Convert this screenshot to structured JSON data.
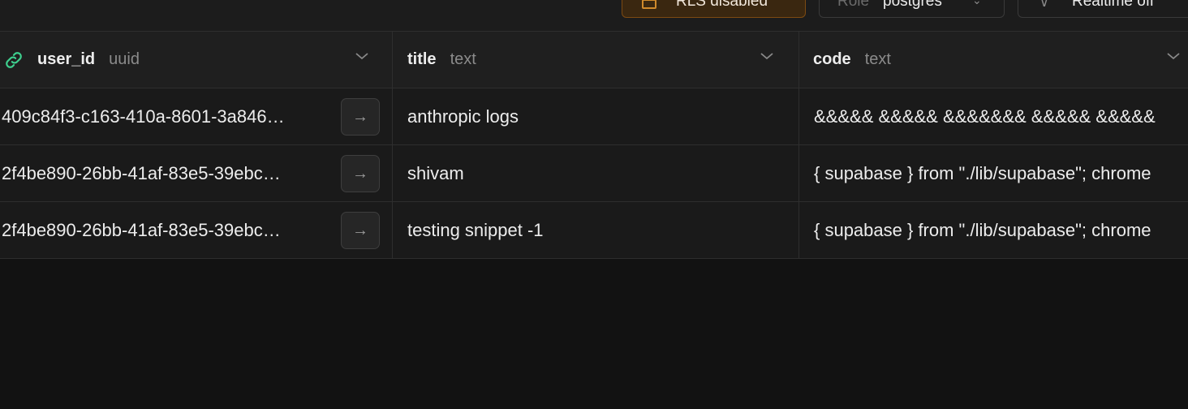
{
  "toolbar": {
    "rls_label": "RLS disabled",
    "role_key": "Role",
    "role_value": "postgres",
    "realtime_label": "Realtime off"
  },
  "columns": [
    {
      "name": "user_id",
      "type": "uuid"
    },
    {
      "name": "title",
      "type": "text"
    },
    {
      "name": "code",
      "type": "text"
    }
  ],
  "rows": [
    {
      "user_id": "409c84f3-c163-410a-8601-3a846…",
      "title": "anthropic logs",
      "code": "&&&&& &&&&& &&&&&&& &&&&& &&&&&"
    },
    {
      "user_id": "2f4be890-26bb-41af-83e5-39ebc…",
      "title": "shivam",
      "code": "{ supabase } from \"./lib/supabase\"; chrome"
    },
    {
      "user_id": "2f4be890-26bb-41af-83e5-39ebc…",
      "title": "testing snippet -1",
      "code": "{ supabase } from \"./lib/supabase\"; chrome"
    }
  ],
  "colors": {
    "background": "#121212",
    "accent_warning": "#d08a2c",
    "link_icon": "#3ecf8e"
  },
  "icons": {
    "link": "link-icon",
    "chevron": "chevron-down-icon",
    "arrow": "arrow-right-icon",
    "lock": "lock-icon"
  }
}
